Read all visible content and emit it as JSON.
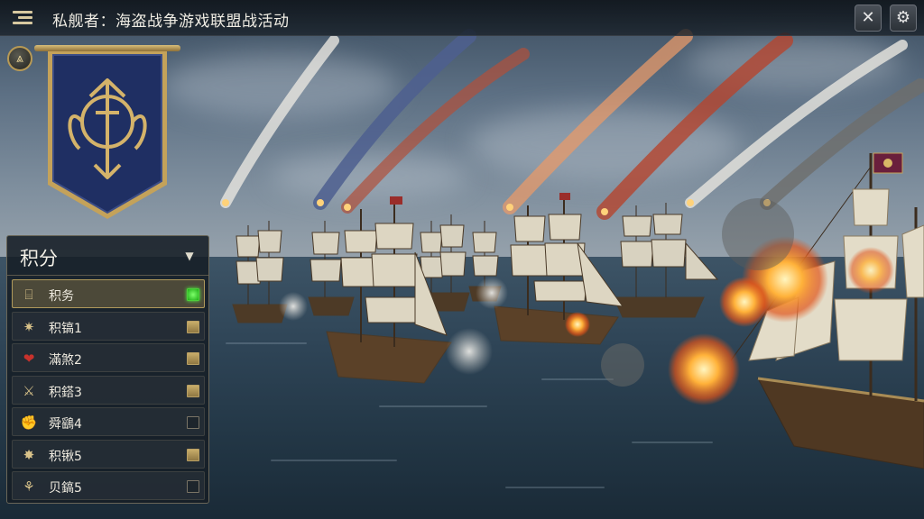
{
  "header": {
    "title": "私舰者：海盗战争游戏联盟战活动"
  },
  "icons": {
    "menu": "menu-icon",
    "close": "close-icon",
    "settings": "gear-icon",
    "rank": "rank-chevron-icon",
    "banner": "guild-emblem-icon"
  },
  "panel": {
    "title": "积分",
    "toggle_glyph": "▼",
    "rows": [
      {
        "label": "积务",
        "icon": "treasure-chest-icon",
        "glyph": "⌸",
        "state": "green"
      },
      {
        "label": "积镐1",
        "icon": "gear-badge-icon",
        "glyph": "✷",
        "state": "gold"
      },
      {
        "label": "滿煞2",
        "icon": "heart-icon",
        "glyph": "❤",
        "state": "gold"
      },
      {
        "label": "积鎝3",
        "icon": "sword-icon",
        "glyph": "⚔",
        "state": "gold"
      },
      {
        "label": "舜鷂4",
        "icon": "fist-icon",
        "glyph": "✊",
        "state": "empty"
      },
      {
        "label": "积锹5",
        "icon": "star-badge-icon",
        "glyph": "✸",
        "state": "gold"
      },
      {
        "label": "贝鎬5",
        "icon": "rune-icon",
        "glyph": "⚘",
        "state": "empty"
      }
    ]
  },
  "colors": {
    "accent_gold": "#c8ad6a",
    "active_green": "#55ff44",
    "banner_blue": "#1f2f63",
    "banner_trim": "#c4a25a"
  }
}
